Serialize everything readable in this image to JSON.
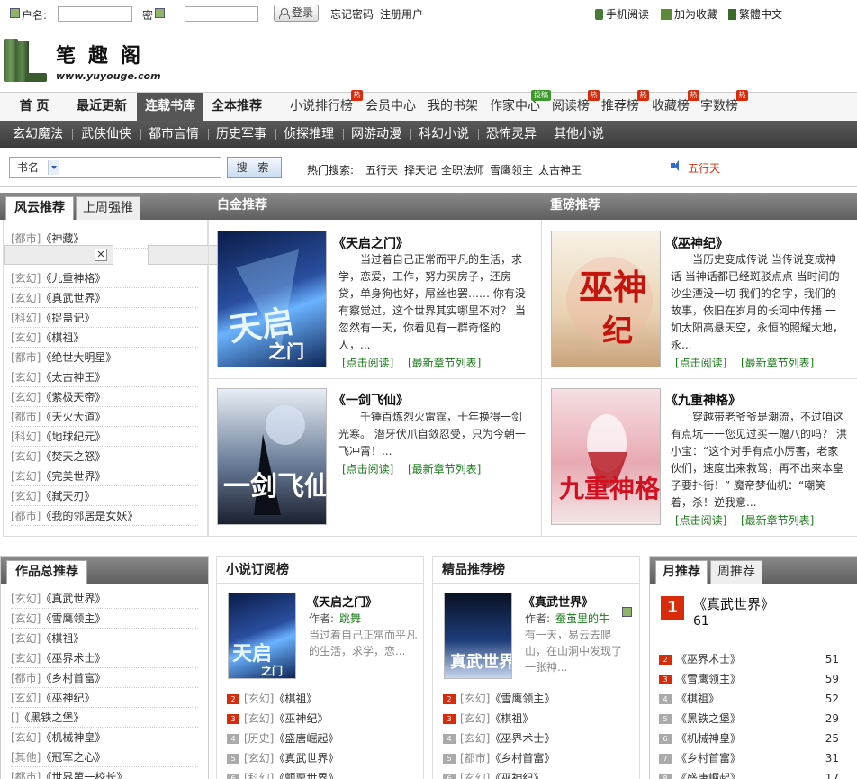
{
  "topbar": {
    "user_label": "户名:",
    "pass_label": "密",
    "login_btn": "登录",
    "forgot": "忘记密码",
    "register": "注册用户",
    "mobile": "手机阅读",
    "bookmark": "加为收藏",
    "traditional": "繁體中文"
  },
  "logo": {
    "title": "笔趣阁",
    "url": "www.yuyouge.com"
  },
  "mainnav": {
    "items": [
      "首 页",
      "最近更新",
      "连载书库",
      "全本推荐"
    ],
    "sub": [
      "小说排行榜",
      "会员中心",
      "我的书架",
      "作家中心",
      "阅读榜",
      "推荐榜",
      "收藏榜",
      "字数榜"
    ],
    "badge_hot": "热",
    "badge_new": "投稿"
  },
  "genres": [
    "玄幻魔法",
    "武侠仙侠",
    "都市言情",
    "历史军事",
    "侦探推理",
    "网游动漫",
    "科幻小说",
    "恐怖灵异",
    "其他小说"
  ],
  "search": {
    "type": "书名",
    "button": "搜 索",
    "hot_label": "热门搜索:",
    "hot_words": [
      "五行天",
      "择天记",
      "全职法师",
      "雪鹰领主",
      "太古神王"
    ],
    "notice": "五行天"
  },
  "fengyun": {
    "tabs": [
      "风云推荐",
      "上周强推"
    ],
    "items": [
      {
        "cat": "[都市]",
        "title": "《神藏》"
      },
      {
        "cat": "[玄幻]",
        "title": "《九重神格》"
      },
      {
        "cat": "[玄幻]",
        "title": "《真武世界》"
      },
      {
        "cat": "[科幻]",
        "title": "《捉蛊记》"
      },
      {
        "cat": "[玄幻]",
        "title": "《棋祖》"
      },
      {
        "cat": "[都市]",
        "title": "《绝世大明星》"
      },
      {
        "cat": "[玄幻]",
        "title": "《太古神王》"
      },
      {
        "cat": "[玄幻]",
        "title": "《紫极天帝》"
      },
      {
        "cat": "[都市]",
        "title": "《天火大道》"
      },
      {
        "cat": "[科幻]",
        "title": "《地球纪元》"
      },
      {
        "cat": "[玄幻]",
        "title": "《焚天之怒》"
      },
      {
        "cat": "[玄幻]",
        "title": "《完美世界》"
      },
      {
        "cat": "[玄幻]",
        "title": "《弑天刃》"
      },
      {
        "cat": "[都市]",
        "title": "《我的邻居是女妖》"
      }
    ]
  },
  "baijin": {
    "title": "白金推荐",
    "books": [
      {
        "title": "《天启之门》",
        "desc": "当过着自己正常而平凡的生活，求学，恋爱，工作，努力买房子，还房贷，单身狗也好，屌丝也罢…… 你有没有察觉过，这个世界其实哪里不对？ 当忽然有一天，你看见有一群奇怪的人，...",
        "read": "[点击阅读]",
        "latest": "[最新章节列表]"
      },
      {
        "title": "《一剑飞仙》",
        "desc": "千锤百炼烈火雷霆，十年换得一剑光寒。 潜牙伏爪自敛忍受，只为今朝一飞冲霄！...",
        "read": "[点击阅读]",
        "latest": "[最新章节列表]"
      }
    ]
  },
  "zhongbang": {
    "title": "重磅推荐",
    "books": [
      {
        "title": "《巫神纪》",
        "desc": "当历史变成传说 当传说变成神话 当神话都已经斑驳点点 当时间的沙尘湮没一切 我们的名字，我们的故事，依旧在岁月的长河中传播 一如太阳高悬天空，永恒的照耀大地，永...",
        "read": "[点击阅读]",
        "latest": "[最新章节列表]"
      },
      {
        "title": "《九重神格》",
        "desc": "穿越带老爷爷是潮流，不过咱这有点坑一一您见过买一赠八的吗？ 洪小宝：“这个对手有点小厉害，老家伙们，速度出来救驾，再不出来本皇子要扑街！” 魔帝梦仙机：“嘲笑着，杀！逆我意...",
        "read": "[点击阅读]",
        "latest": "[最新章节列表]"
      }
    ]
  },
  "zongtuijian": {
    "title": "作品总推荐",
    "items": [
      {
        "cat": "[玄幻]",
        "title": "《真武世界》"
      },
      {
        "cat": "[玄幻]",
        "title": "《雪鹰领主》"
      },
      {
        "cat": "[玄幻]",
        "title": "《棋祖》"
      },
      {
        "cat": "[玄幻]",
        "title": "《巫界术士》"
      },
      {
        "cat": "[都市]",
        "title": "《乡村首富》"
      },
      {
        "cat": "[玄幻]",
        "title": "《巫神纪》"
      },
      {
        "cat": "[]",
        "title": "《黑铁之堡》"
      },
      {
        "cat": "[玄幻]",
        "title": "《机械神皇》"
      },
      {
        "cat": "[其他]",
        "title": "《冠军之心》"
      },
      {
        "cat": "[都市]",
        "title": "《世界第一校长》"
      }
    ]
  },
  "dingyue": {
    "title": "小说订阅榜",
    "top": {
      "title": "《天启之门》",
      "author_label": "作者:",
      "author": "跳舞",
      "desc": "当过着自己正常而平凡的生活，求学，恋..."
    },
    "items": [
      {
        "rank": "2",
        "cat": "[玄幻]",
        "title": "《棋祖》"
      },
      {
        "rank": "3",
        "cat": "[玄幻]",
        "title": "《巫神纪》"
      },
      {
        "rank": "4",
        "cat": "[历史]",
        "title": "《盛唐崛起》"
      },
      {
        "rank": "5",
        "cat": "[玄幻]",
        "title": "《真武世界》"
      },
      {
        "rank": "6",
        "cat": "[科幻]",
        "title": "《颤栗世界》"
      }
    ]
  },
  "jingpin": {
    "title": "精品推荐榜",
    "top": {
      "title": "《真武世界》",
      "author_label": "作者:",
      "author": "蚕茧里的牛",
      "desc": "有一天，易云去爬山，在山洞中发现了一张神..."
    },
    "items": [
      {
        "rank": "2",
        "cat": "[玄幻]",
        "title": "《雪鹰领主》"
      },
      {
        "rank": "3",
        "cat": "[玄幻]",
        "title": "《棋祖》"
      },
      {
        "rank": "4",
        "cat": "[玄幻]",
        "title": "《巫界术士》"
      },
      {
        "rank": "5",
        "cat": "[都市]",
        "title": "《乡村首富》"
      },
      {
        "rank": "6",
        "cat": "[玄幻]",
        "title": "《巫神纪》"
      }
    ]
  },
  "yuetuijian": {
    "tabs": [
      "月推荐",
      "周推荐"
    ],
    "top": {
      "rank": "1",
      "title": "《真武世界》",
      "count": "61"
    },
    "items": [
      {
        "rank": "2",
        "title": "《巫界术士》",
        "count": "51"
      },
      {
        "rank": "3",
        "title": "《雪鹰领主》",
        "count": "59"
      },
      {
        "rank": "4",
        "title": "《棋祖》",
        "count": "52"
      },
      {
        "rank": "5",
        "title": "《黑铁之堡》",
        "count": "29"
      },
      {
        "rank": "6",
        "title": "《机械神皇》",
        "count": "25"
      },
      {
        "rank": "7",
        "title": "《乡村首富》",
        "count": "31"
      },
      {
        "rank": "8",
        "title": "《盛唐崛起》",
        "count": "17"
      }
    ]
  },
  "colors": {
    "hot_red": "#d92a0c",
    "link_green": "#1a7a1a",
    "header_gray": "#555555"
  }
}
